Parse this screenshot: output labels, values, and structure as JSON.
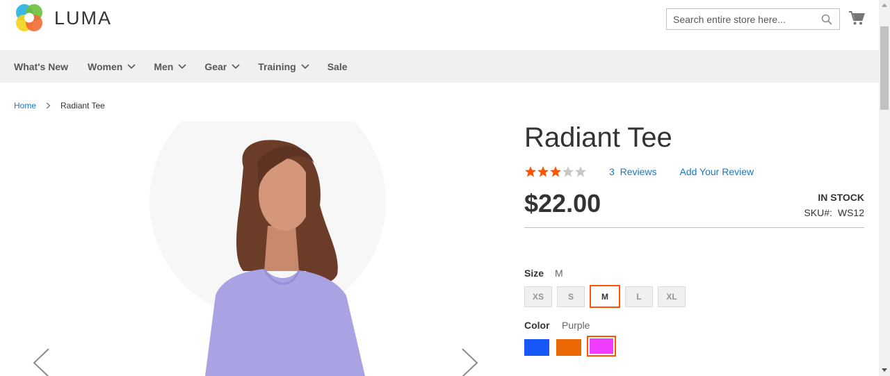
{
  "header": {
    "logo_text": "LUMA",
    "search_placeholder": "Search entire store here...",
    "search_value": ""
  },
  "nav": {
    "items": [
      {
        "label": "What's New",
        "has_dropdown": false
      },
      {
        "label": "Women",
        "has_dropdown": true
      },
      {
        "label": "Men",
        "has_dropdown": true
      },
      {
        "label": "Gear",
        "has_dropdown": true
      },
      {
        "label": "Training",
        "has_dropdown": true
      },
      {
        "label": "Sale",
        "has_dropdown": false
      }
    ]
  },
  "breadcrumb": {
    "home": "Home",
    "current": "Radiant Tee"
  },
  "product": {
    "title": "Radiant Tee",
    "rating_stars": 3,
    "rating_max": 5,
    "reviews_count": "3",
    "reviews_label": "Reviews",
    "add_review_label": "Add Your Review",
    "price": "$22.00",
    "stock_status": "In stock",
    "sku_label": "SKU#:",
    "sku": "WS12"
  },
  "options": {
    "size_label": "Size",
    "size_selected": "M",
    "sizes": [
      "XS",
      "S",
      "M",
      "L",
      "XL"
    ],
    "color_label": "Color",
    "color_selected": "Purple",
    "colors": [
      {
        "name": "Blue",
        "hex": "#1857f7"
      },
      {
        "name": "Orange",
        "hex": "#eb6703"
      },
      {
        "name": "Purple",
        "hex": "#ef3dff"
      }
    ]
  },
  "colors": {
    "accent_link": "#1979c3",
    "selected_border": "#ff5501",
    "star_filled": "#ff5501",
    "star_empty": "#c7c7c7",
    "shirt": "#a9a3e3"
  },
  "icons": {
    "search": "search-icon",
    "cart": "cart-icon",
    "chevron": "chevron-down-icon",
    "prev": "chevron-left-icon",
    "next": "chevron-right-icon"
  }
}
